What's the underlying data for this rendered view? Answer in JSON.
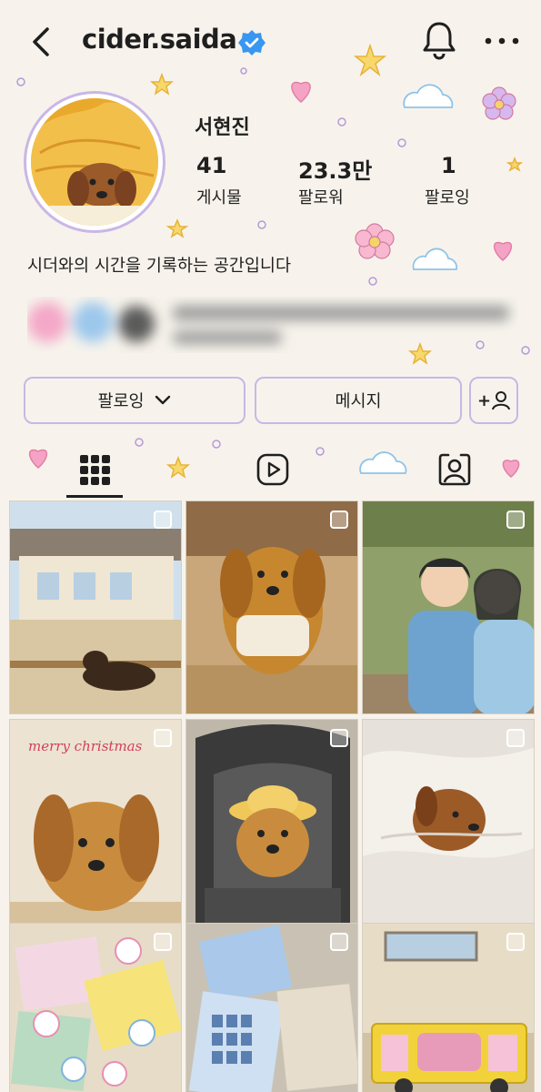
{
  "header": {
    "username": "cider.saida",
    "icons": [
      "back-arrow-icon",
      "verified-badge-icon",
      "bell-icon",
      "more-icon"
    ]
  },
  "profile": {
    "display_name": "서현진",
    "stats": [
      {
        "value": "41",
        "label": "게시물"
      },
      {
        "value": "23.3만",
        "label": "팔로워"
      },
      {
        "value": "1",
        "label": "팔로잉"
      }
    ],
    "bio": "시더와의 시간을 기록하는 공간입니다"
  },
  "actions": {
    "follow_label": "팔로잉",
    "message_label": "메시지",
    "add_person_label": "+"
  },
  "tabs": [
    {
      "name": "grid",
      "icon": "grid-icon",
      "active": true
    },
    {
      "name": "reels",
      "icon": "reels-icon",
      "active": false
    },
    {
      "name": "tagged",
      "icon": "tagged-icon",
      "active": false
    }
  ],
  "posts": [
    {
      "caption": ""
    },
    {
      "caption": ""
    },
    {
      "caption": ""
    },
    {
      "caption": "merry christmas"
    },
    {
      "caption": ""
    },
    {
      "caption": ""
    },
    {
      "caption": ""
    },
    {
      "caption": ""
    },
    {
      "caption": ""
    }
  ],
  "colors": {
    "background": "#f7f3ec",
    "button_border": "#c9b7e6",
    "verified": "#3897f0"
  }
}
